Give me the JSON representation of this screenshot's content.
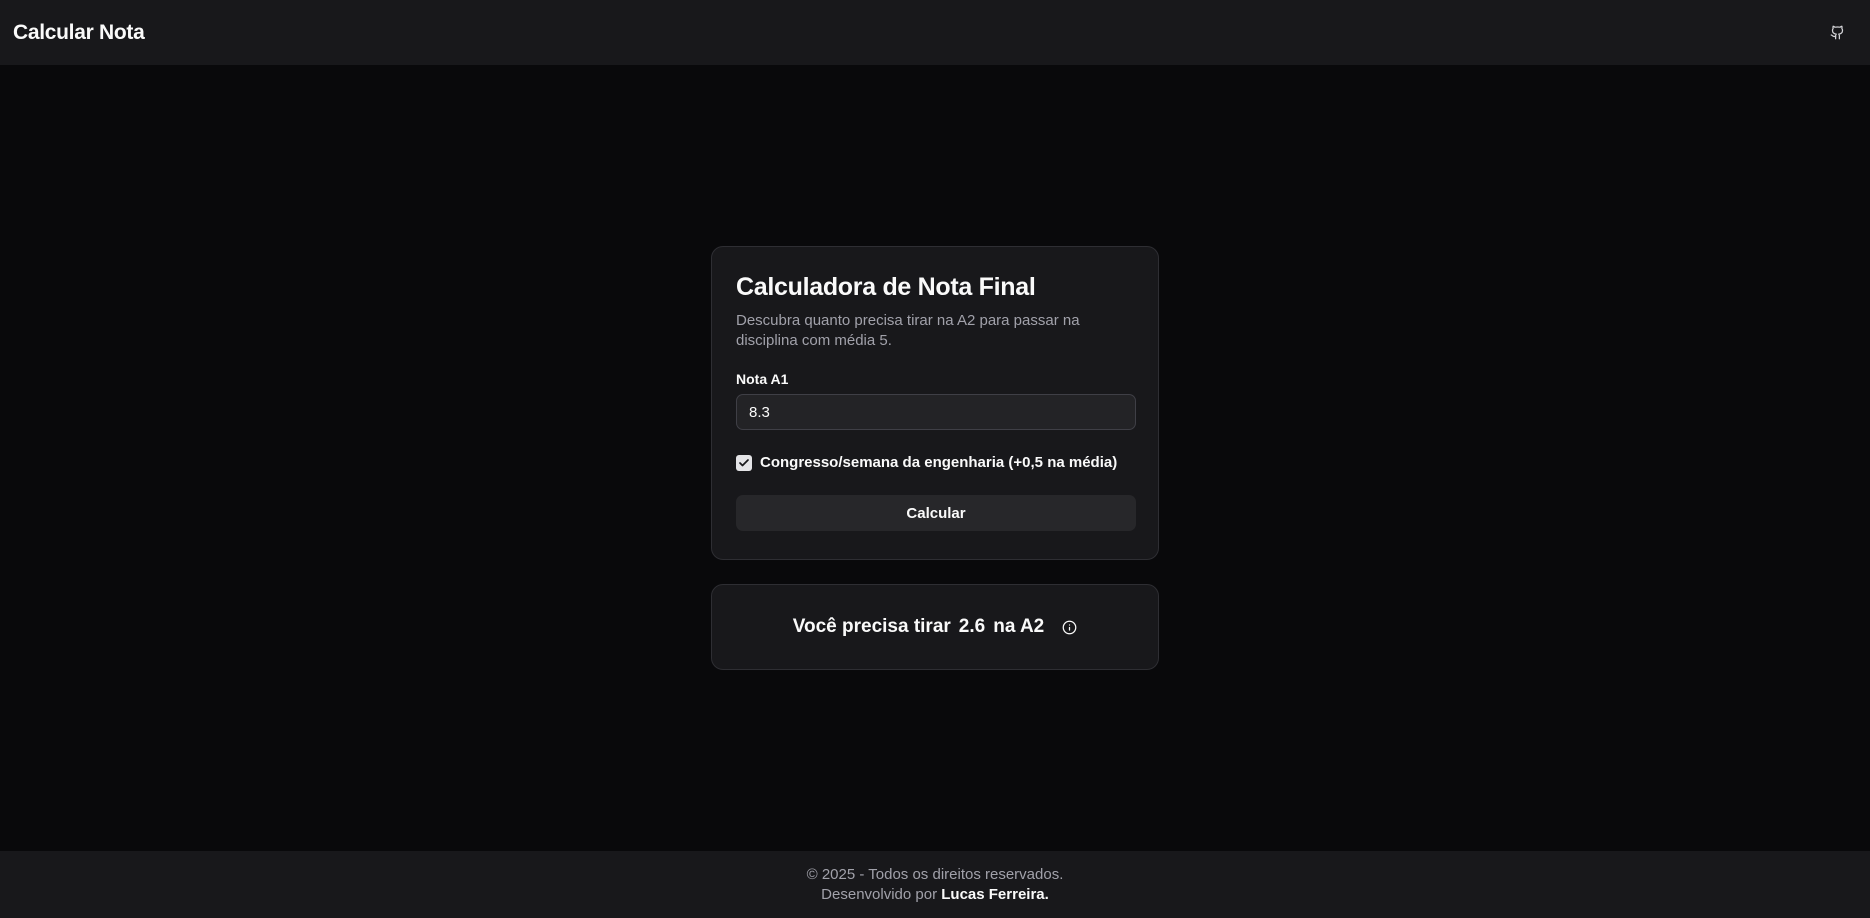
{
  "header": {
    "brand": "Calcular Nota",
    "github_icon": "github-icon"
  },
  "calculator": {
    "title": "Calculadora de Nota Final",
    "description": "Descubra quanto precisa tirar na A2 para passar na disciplina com média 5.",
    "nota_label": "Nota A1",
    "nota_value": "8.3",
    "checkbox_label": "Congresso/semana da engenharia (+0,5 na média)",
    "checkbox_checked": true,
    "button_label": "Calcular"
  },
  "result": {
    "prefix": "Você precisa tirar",
    "value": "2.6",
    "suffix": "na A2",
    "info_icon": "info-icon"
  },
  "footer": {
    "copyright": "© 2025 - Todos os direitos reservados.",
    "dev_prefix": "Desenvolvido por",
    "author": "Lucas Ferreira."
  }
}
